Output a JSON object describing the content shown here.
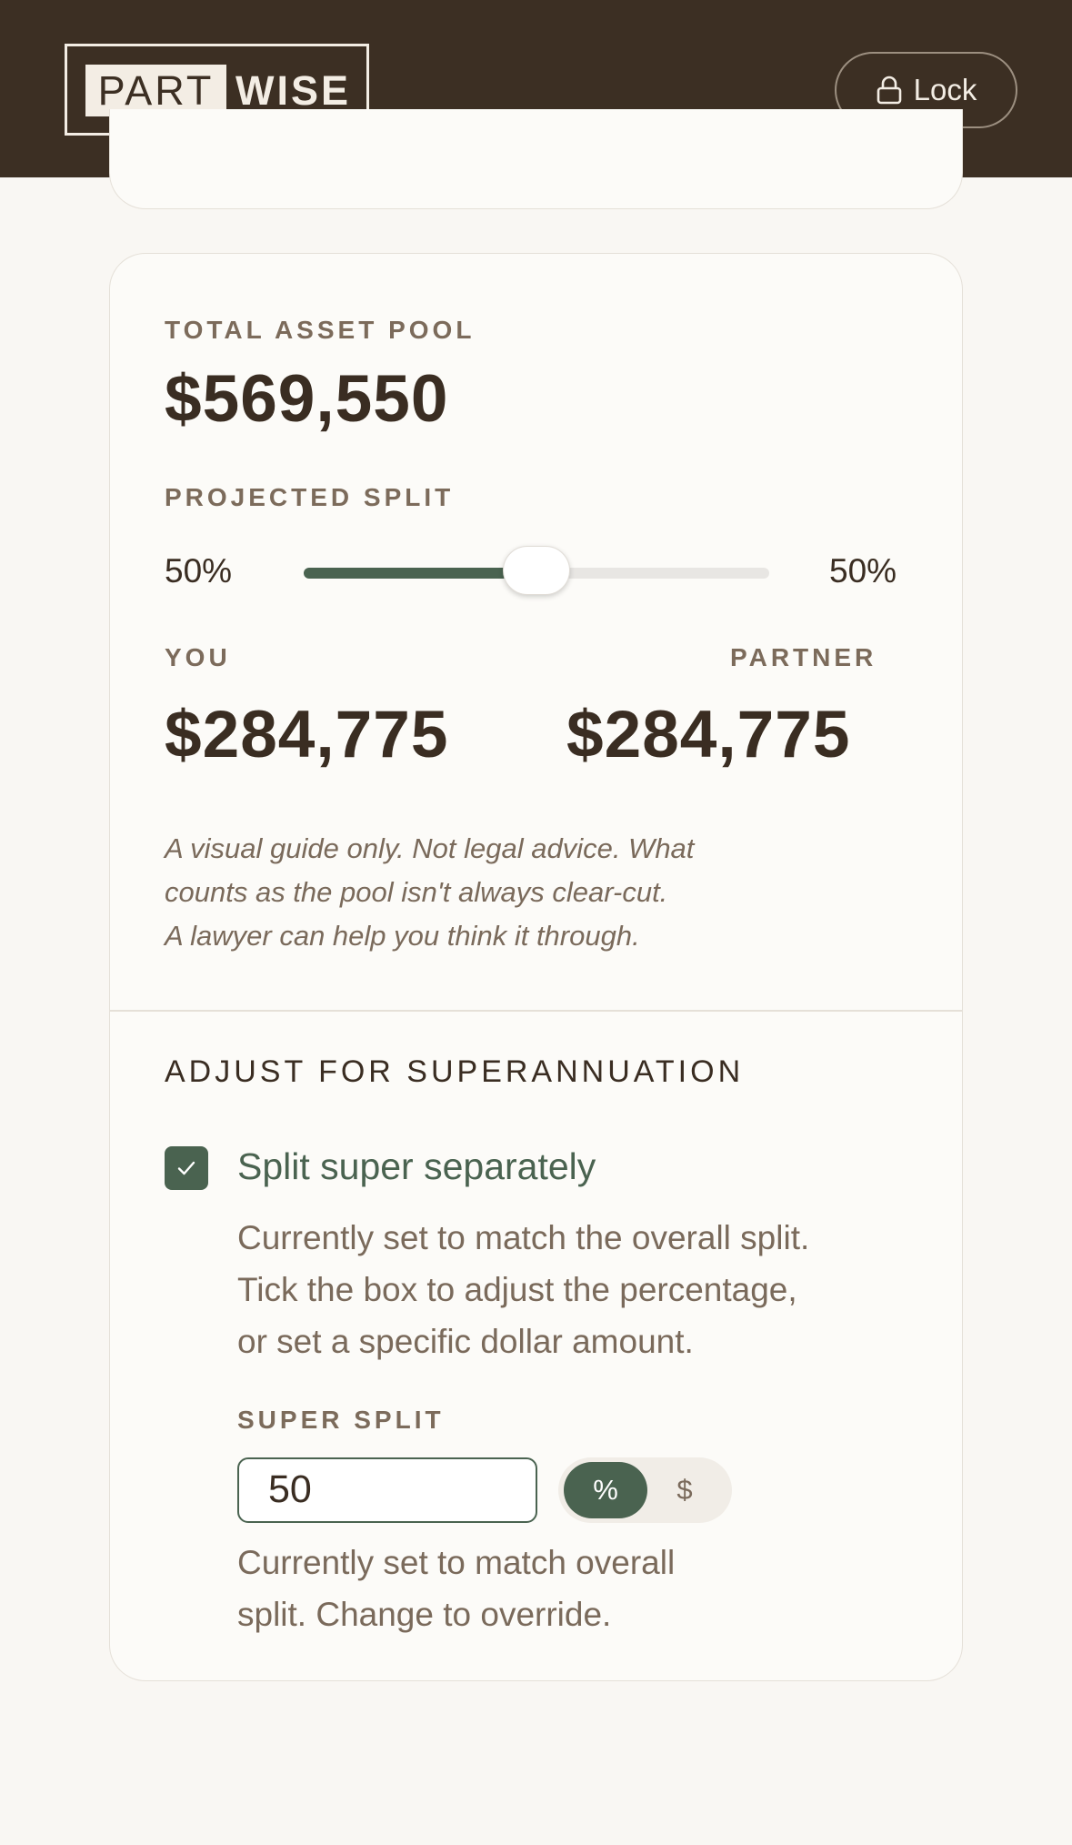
{
  "header": {
    "logo_part": "PART",
    "logo_wise": "WISE",
    "lock_label": "Lock"
  },
  "summary": {
    "pool_label": "TOTAL ASSET POOL",
    "pool_amount": "$569,550",
    "split_label": "PROJECTED SPLIT",
    "left_pct": "50%",
    "right_pct": "50%",
    "slider_fraction": 0.5,
    "you_label": "YOU",
    "partner_label": "PARTNER",
    "you_amount": "$284,775",
    "partner_amount": "$284,775",
    "disclaimer": [
      "A visual guide only. Not legal advice. What",
      "counts as the pool isn't always clear-cut.",
      "A lawyer can help you think it through."
    ]
  },
  "super": {
    "title": "ADJUST FOR SUPERANNUATION",
    "checkbox_label": "Split super separately",
    "checked": true,
    "help": [
      "Currently set to match the overall split.",
      "Tick the box to adjust the percentage,",
      "or set a specific dollar amount."
    ],
    "split_label": "SUPER SPLIT",
    "input_value": "50",
    "toggle_percent": "%",
    "toggle_dollar": "$",
    "note": [
      "Currently set to match overall",
      "split. Change to override."
    ]
  },
  "colors": {
    "header_bg": "#3c2f23",
    "accent_green": "#4a6350",
    "page_bg": "#f9f7f3"
  },
  "icons": {
    "lock": "lock-icon",
    "check": "check-icon"
  }
}
